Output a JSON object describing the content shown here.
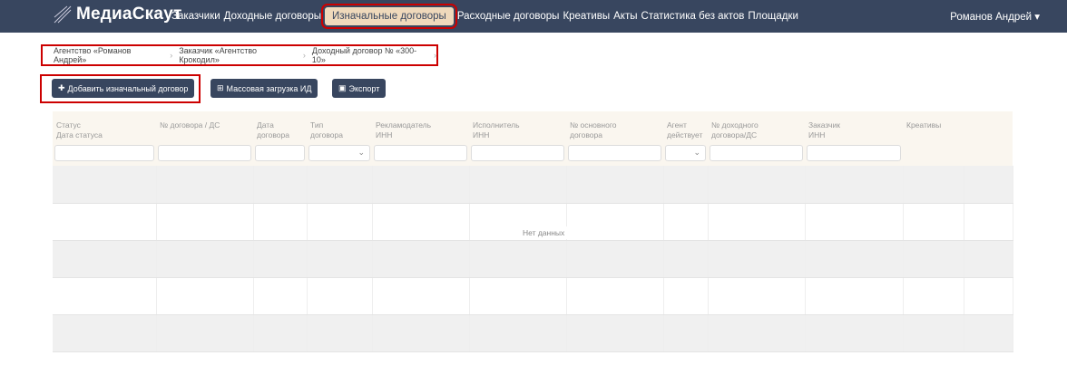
{
  "brand": "МедиаСкаут",
  "nav": {
    "items": [
      "Заказчики",
      "Доходные договоры"
    ],
    "active": "Изначальные договоры",
    "items_after": [
      "Расходные договоры",
      "Креативы",
      "Акты",
      "Статистика без актов",
      "Площадки"
    ],
    "user": "Романов Андрей ▾"
  },
  "breadcrumb": [
    "Агентство «Романов Андрей»",
    "Заказчик «Агентство Крокодил»",
    "Доходный договор № «300-10»"
  ],
  "buttons": {
    "add": "Добавить изначальный договор",
    "bulk": "Массовая загрузка ИД",
    "export": "Экспорт"
  },
  "table": {
    "columns": [
      [
        "Статус",
        "Дата статуса"
      ],
      [
        "№ договора / ДС",
        ""
      ],
      [
        "Дата",
        "договора"
      ],
      [
        "Тип",
        "договора"
      ],
      [
        "Рекламодатель",
        "ИНН"
      ],
      [
        "Исполнитель",
        "ИНН"
      ],
      [
        "№ основного",
        "договора"
      ],
      [
        "Агент",
        "действует"
      ],
      [
        "№ доходного",
        "договора/ДС"
      ],
      [
        "Заказчик",
        "ИНН"
      ],
      [
        "Креативы",
        ""
      ],
      [
        "",
        ""
      ]
    ],
    "filters": [
      "text",
      "text",
      "text",
      "select",
      "text",
      "text",
      "text",
      "select",
      "text",
      "text",
      "none",
      "none"
    ],
    "empty": "Нет данных"
  },
  "colors": {
    "nav": "#38465f",
    "active": "#efd9bb",
    "highlight": "#cc0000"
  }
}
